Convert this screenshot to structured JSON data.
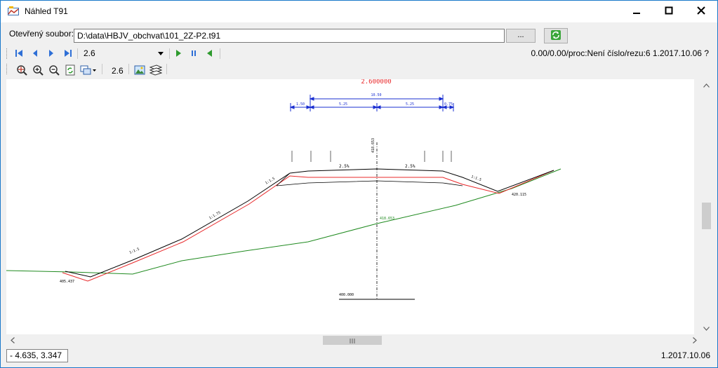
{
  "window": {
    "title": "Náhled T91",
    "icons": {
      "app": "profile-preview-app-icon",
      "minimize": "minimize-icon",
      "maximize": "maximize-icon",
      "close": "close-icon"
    }
  },
  "file": {
    "label": "Otevřený soubor:",
    "path": "D:\\data\\HBJV_obchvat\\101_2Z-P2.t91",
    "browse_label": "...",
    "refresh_icon": "refresh-icon"
  },
  "navigation": {
    "section_value": "2.6",
    "status": "0.00/0.00/proc:Není číslo/rezu:6   1.2017.10.06  ?",
    "icons": [
      "first-section-icon",
      "previous-section-icon",
      "next-section-icon",
      "last-section-icon",
      "play-icon",
      "pause-icon",
      "play-backward-icon"
    ]
  },
  "toolbar": {
    "scale_value": "2.6",
    "icons": [
      "zoom-extents-icon",
      "zoom-in-icon",
      "zoom-out-icon",
      "redraw-icon",
      "window-layout-icon",
      "export-image-icon",
      "layers-icon"
    ]
  },
  "drawing": {
    "station_label": "2.600000",
    "overall_width": "10.50",
    "left_shoulder": "1.50",
    "left_lane": "5.25",
    "right_lane": "5.25",
    "right_shoulder": "0.75",
    "left_slope_upper": "1:1.5",
    "left_slope_mid": "1:1.75",
    "left_slope_lower": "1:1.5",
    "right_slope": "1:1.5",
    "left_lane_slope": "2.5%",
    "right_lane_slope": "2.5%",
    "axis_height_label": "418.653",
    "left_toe_label": "405.437",
    "right_toe_label": "420.115",
    "datum_label": "400.000",
    "colors": {
      "design": "#e8282a",
      "terrain": "#1f8a1f",
      "dimensions": "#1a2fd1",
      "structure": "#000000"
    }
  },
  "statusbar": {
    "coordinates": "-  4.635,   3.347",
    "version": "1.2017.10.06"
  }
}
